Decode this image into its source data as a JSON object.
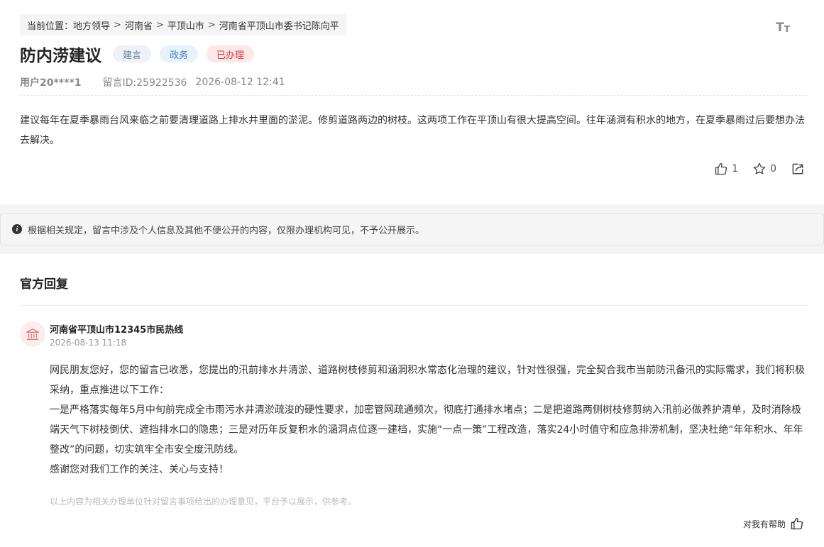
{
  "breadcrumb": {
    "prefix": "当前位置：",
    "items": [
      "地方领导",
      "河南省",
      "平顶山市",
      "河南省平顶山市委书记陈向平"
    ],
    "separator": ">"
  },
  "font_toggle": {
    "big": "T",
    "small": "T"
  },
  "message": {
    "title": "防内涝建议",
    "tags": [
      {
        "label": "建言",
        "bg": "#eef2f7",
        "color": "#6a7d94"
      },
      {
        "label": "政务",
        "bg": "#e8f2fb",
        "color": "#3d7dbf"
      },
      {
        "label": "已办理",
        "bg": "#fde8e8",
        "color": "#d9343a"
      }
    ],
    "user": "用户20****1",
    "message_id": "留言ID:25922536",
    "datetime": "2026-08-12 12:41",
    "content": "建议每年在夏季暴雨台风来临之前要清理道路上排水井里面的淤泥。修剪道路两边的树枝。这两项工作在平顶山有很大提高空间。往年涵洞有积水的地方，在夏季暴雨过后要想办法去解决。",
    "likes": "1",
    "favorites": "0"
  },
  "notice": {
    "text": "根据相关规定，留言中涉及个人信息及其他不便公开的内容，仅限办理机构可见，不予公开展示。"
  },
  "reply": {
    "heading": "官方回复",
    "org_name": "河南省平顶山市12345市民热线",
    "datetime": "2026-08-13 11:18",
    "paragraphs": [
      "网民朋友您好，您的留言已收悉，您提出的汛前排水井清淤、道路树枝修剪和涵洞积水常态化治理的建议，针对性很强，完全契合我市当前防汛备汛的实际需求，我们将积极采纳，重点推进以下工作：",
      "一是严格落实每年5月中旬前完成全市雨污水井清淤疏浚的硬性要求，加密管网疏通频次，彻底打通排水堵点；二是把道路两侧树枝修剪纳入汛前必做养护清单，及时消除极端天气下树枝倒伏、遮挡排水口的隐患；三是对历年反复积水的涵洞点位逐一建档，实施“一点一策”工程改造，落实24小时值守和应急排涝机制，坚决杜绝“年年积水、年年整改”的问题，切实筑牢全市安全度汛防线。",
      "感谢您对我们工作的关注、关心与支持！"
    ],
    "disclaimer": "以上内容为相关办理单位针对留言事项给出的办理意见，平台予以展示，供参考。",
    "helpful_label": "对我有帮助"
  },
  "colors": {
    "accent_red": "#d9343a",
    "avatar_bg": "#fdeeee",
    "avatar_icon": "#e07a7a"
  },
  "icons": [
    "font-size-icon",
    "thumbs-up-icon",
    "star-icon",
    "share-icon",
    "info-icon",
    "government-building-icon"
  ]
}
